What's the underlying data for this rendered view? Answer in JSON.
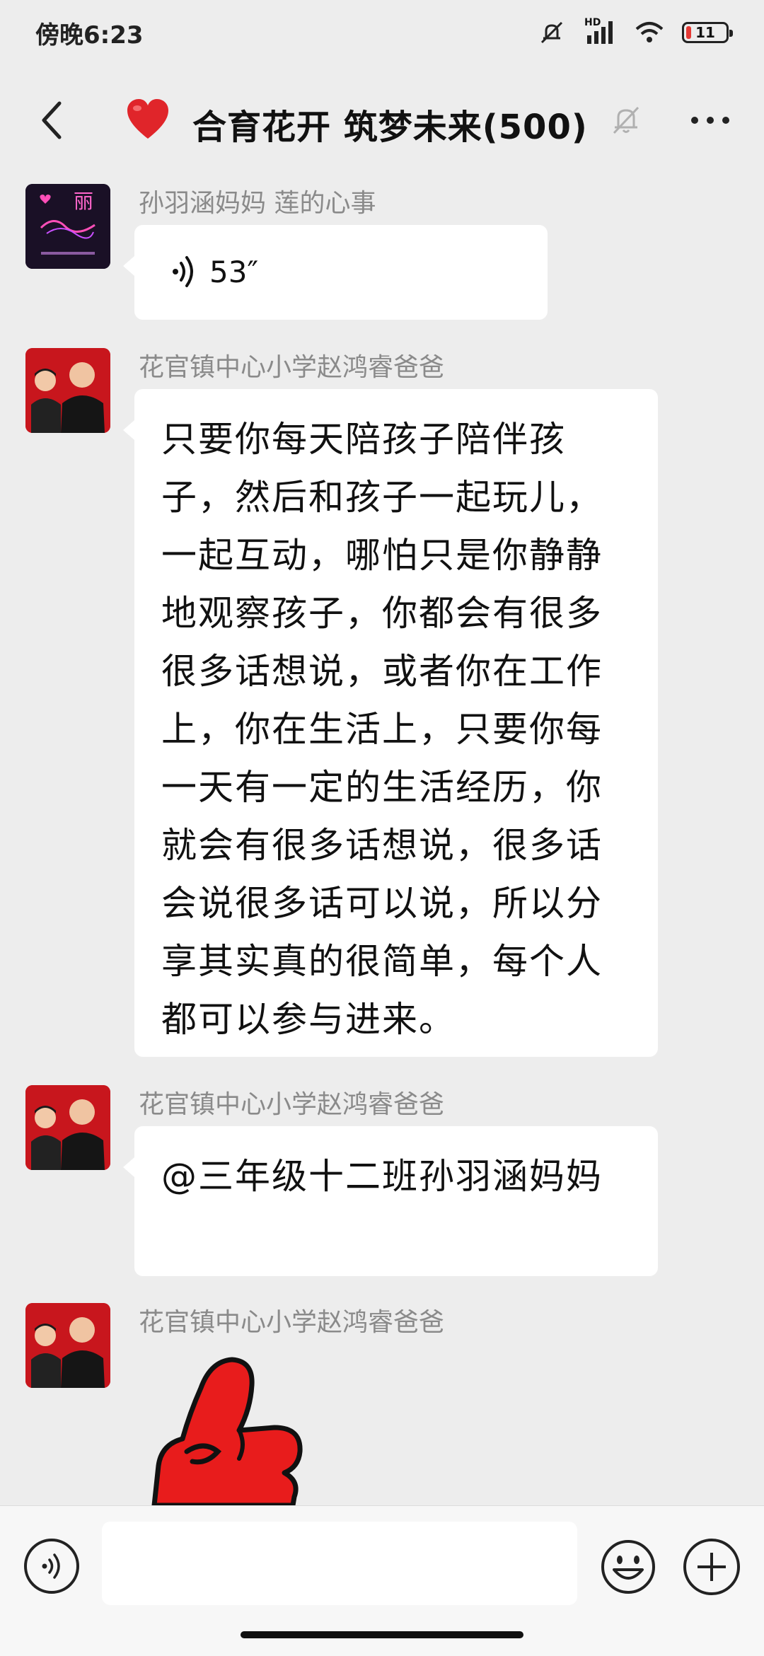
{
  "status_bar": {
    "time": "傍晚6:23",
    "network": "HD",
    "battery": "11"
  },
  "header": {
    "title": "合育花开 筑梦未来(500)"
  },
  "messages": [
    {
      "sender": "孙羽涵妈妈  莲的心事",
      "type": "voice",
      "duration": "53″",
      "avatar_text": "丽"
    },
    {
      "sender": "花官镇中心小学赵鸿睿爸爸",
      "type": "text",
      "text": "只要你每天陪孩子陪伴孩子，然后和孩子一起玩儿，一起互动，哪怕只是你静静地观察孩子，你都会有很多很多话想说，或者你在工作上，你在生活上，只要你每一天有一定的生活经历，你就会有很多话想说，很多话会说很多话可以说，所以分享其实真的很简单，每个人都可以参与进来。"
    },
    {
      "sender": "花官镇中心小学赵鸿睿爸爸",
      "type": "text",
      "text": "@三年级十二班孙羽涵妈妈"
    },
    {
      "sender": "花官镇中心小学赵鸿睿爸爸",
      "type": "sticker",
      "sticker": "thumbs-up"
    }
  ],
  "input": {
    "placeholder": ""
  },
  "icons": [
    "back-icon",
    "heart-icon",
    "mute-icon",
    "more-icon",
    "voice-icon",
    "emoji-icon",
    "plus-icon"
  ],
  "colors": {
    "background": "#ededed",
    "bubble": "#ffffff",
    "sender": "#8a8a8a",
    "heart": "#e0252a",
    "sticker": "#e81c1c"
  }
}
